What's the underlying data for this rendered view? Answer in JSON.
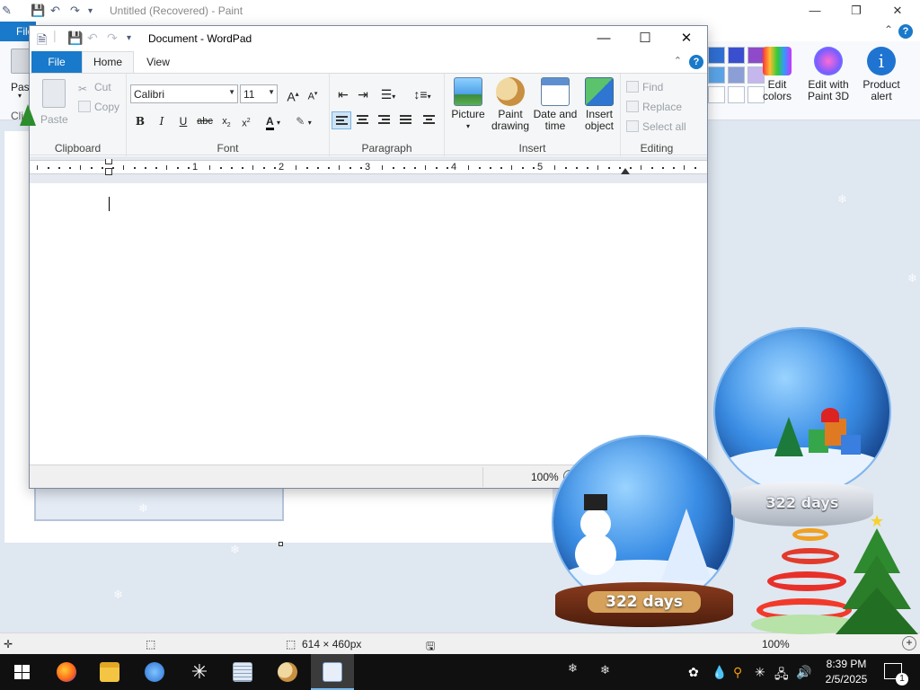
{
  "paint": {
    "title": "Untitled (Recovered) - Paint",
    "file_tab": "File",
    "paste_label": "Paste",
    "clipboard_partial": "Cli",
    "ribbon": {
      "edit_colors": "Edit colors",
      "edit_paint3d": "Edit with Paint 3D",
      "product_alert": "Product alert"
    },
    "status": {
      "dimensions": "614 × 460px",
      "zoom": "100%"
    },
    "palette_colors": [
      "#2f6fd1",
      "#3a4ed0",
      "#8e4ac8",
      "#5aa3e6",
      "#8b9ed6",
      "#c6b6ee"
    ]
  },
  "wordpad": {
    "title": "Document - WordPad",
    "tabs": {
      "file": "File",
      "home": "Home",
      "view": "View"
    },
    "clipboard": {
      "paste": "Paste",
      "cut": "Cut",
      "copy": "Copy",
      "label": "Clipboard"
    },
    "font": {
      "family": "Calibri",
      "size": "11",
      "label": "Font"
    },
    "paragraph": {
      "label": "Paragraph"
    },
    "insert": {
      "picture": "Picture",
      "paint_drawing_1": "Paint",
      "paint_drawing_2": "drawing",
      "date_time_1": "Date and",
      "date_time_2": "time",
      "insert_object_1": "Insert",
      "insert_object_2": "object",
      "label": "Insert"
    },
    "editing": {
      "find": "Find",
      "replace": "Replace",
      "select_all": "Select all",
      "label": "Editing"
    },
    "ruler_numbers": [
      "1",
      "2",
      "3",
      "4",
      "5"
    ],
    "zoom": "100%"
  },
  "gadgets": {
    "globe_days_1": "322 days",
    "globe_days_2": "322 days"
  },
  "taskbar": {
    "time": "8:39 PM",
    "date": "2/5/2025",
    "notification_count": "1"
  },
  "colors": {
    "accent": "#1979ca",
    "taskbar": "#101010"
  }
}
